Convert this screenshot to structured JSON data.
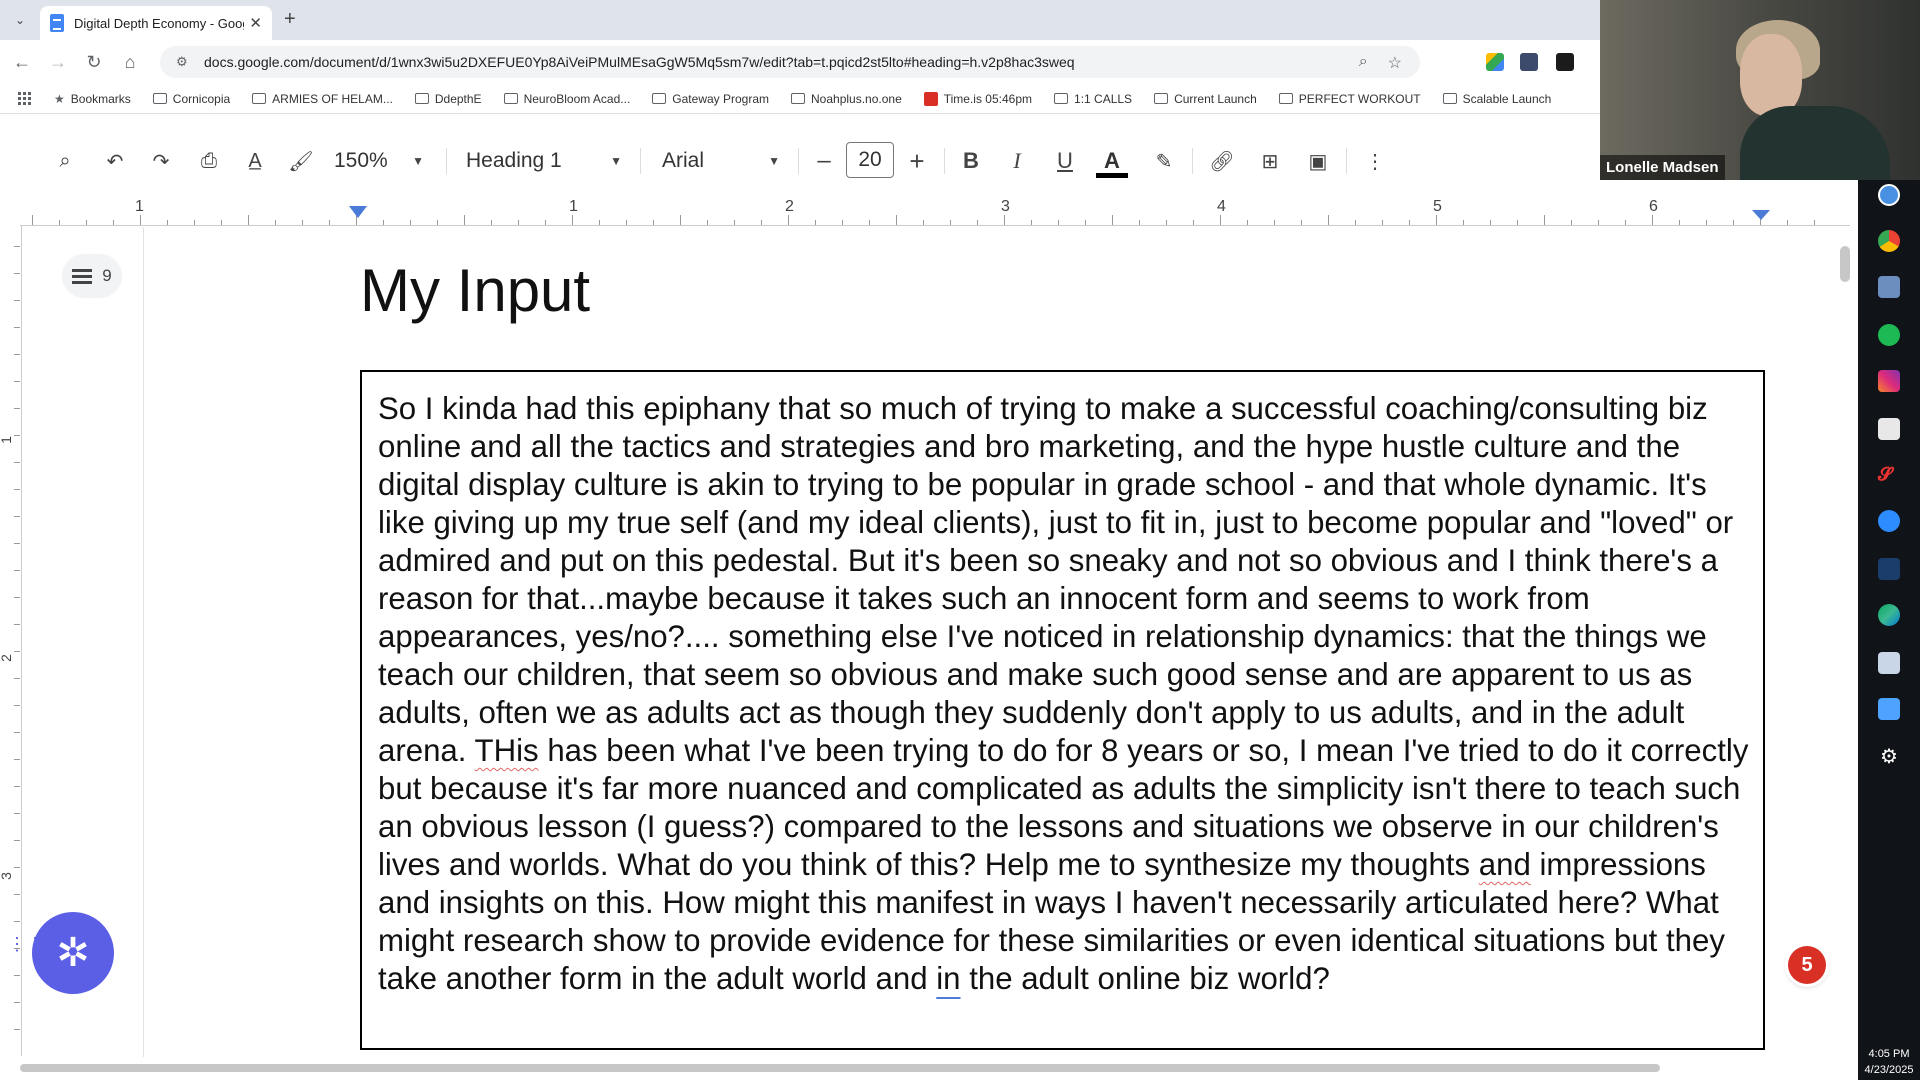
{
  "browser": {
    "tab_title": "Digital Depth Economy - Google Docs",
    "url": "docs.google.com/document/d/1wnx3wi5u2DXEFUE0Yp8AiVeiPMulMEsaGgW5Mq5sm7w/edit?tab=t.pqicd2st5lto#heading=h.v2p8hac3sweq",
    "bookmarks": [
      {
        "label": "Bookmarks",
        "icon": "star-icon"
      },
      {
        "label": "Cornicopia",
        "icon": "folder-icon"
      },
      {
        "label": "ARMIES OF HELAM...",
        "icon": "folder-icon"
      },
      {
        "label": "DdepthE",
        "icon": "folder-icon"
      },
      {
        "label": "NeuroBloom Acad...",
        "icon": "folder-icon"
      },
      {
        "label": "Gateway Program",
        "icon": "folder-icon"
      },
      {
        "label": "Noahplus.no.one",
        "icon": "folder-icon"
      },
      {
        "label": "Time.is 05:46pm",
        "icon": "red-square-icon"
      },
      {
        "label": "1:1 CALLS",
        "icon": "folder-icon"
      },
      {
        "label": "Current Launch",
        "icon": "folder-icon"
      },
      {
        "label": "PERFECT WORKOUT",
        "icon": "folder-icon"
      },
      {
        "label": "Scalable Launch",
        "icon": "folder-icon"
      }
    ]
  },
  "toolbar": {
    "zoom": "150%",
    "style": "Heading 1",
    "font": "Arial",
    "font_size": "20",
    "minus": "–",
    "plus": "+",
    "bold": "B",
    "italic": "I",
    "underline": "U",
    "text_color": "A"
  },
  "ruler": {
    "h_labels": [
      "1",
      "1",
      "2",
      "3",
      "4",
      "5",
      "6"
    ],
    "v_labels": [
      "1",
      "2",
      "3"
    ]
  },
  "outline": {
    "count": "9"
  },
  "document": {
    "title": "My Input",
    "body_parts": [
      "So I kinda had this epiphany that so much of trying to make a successful coaching/consulting biz online and all the tactics and strategies and bro marketing, and the hype hustle culture and the digital display culture is akin to trying to be popular in grade school - and that whole dynamic. It's like giving up my true self (and my ideal clients), just to fit in, just to become popular and \"loved\" or admired and put on this pedestal. But it's been so sneaky and not so obvious and I think there's a reason for that...maybe because it takes such an innocent form and seems to work from appearances, yes/no?.... something else I've noticed in relationship dynamics: that the things we teach our children, that seem so obvious and make such good sense and are apparent to us as adults, often we as adults act as though they suddenly don't apply to us adults, and in the adult arena. ",
      "THis",
      " has been what I've been trying to do for 8 years or so, I mean I've tried to do it correctly but because it's far more nuanced and complicated as adults the simplicity isn't there to teach such an obvious lesson (I guess?) compared to the lessons and situations we observe in our children's lives and worlds. What do you think of this? Help me to synthesize my thoughts ",
      "and",
      " impressions and insights on this. How might this manifest in ways I haven't necessarily articulated here? What might research show to provide evidence for these similarities or even identical situations but they take another form in the adult world and ",
      "in",
      " the adult online biz world?"
    ]
  },
  "notification_count": "5",
  "webcam": {
    "name": "Lonelle Madsen"
  },
  "clock": {
    "time": "4:05 PM",
    "date": "4/23/2025"
  },
  "colors": {
    "accent": "#4a7bd6",
    "fab": "#5b5fe6",
    "badge": "#d93025"
  }
}
